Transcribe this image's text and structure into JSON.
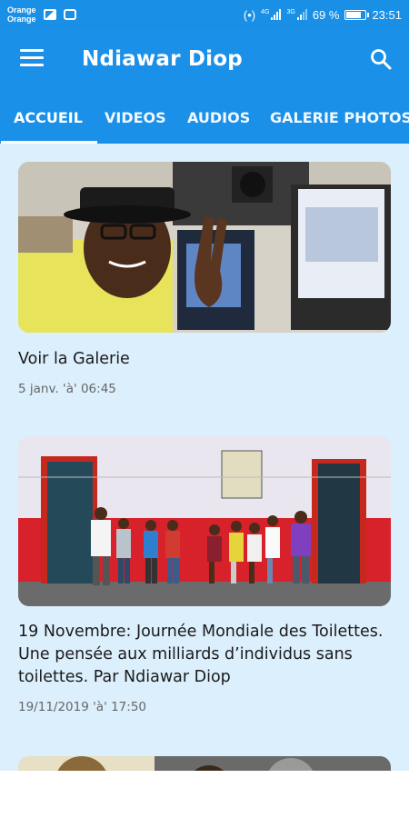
{
  "status_bar": {
    "carrier_line1": "Orange",
    "carrier_line2": "Orange",
    "network1": "4G",
    "network2": "3G",
    "battery_text": "69 %",
    "battery_level": 0.69,
    "time": "23:51"
  },
  "app_bar": {
    "title": "Ndiawar Diop"
  },
  "tabs": [
    {
      "label": "ACCUEIL",
      "active": true
    },
    {
      "label": "VIDEOS",
      "active": false
    },
    {
      "label": "AUDIOS",
      "active": false
    },
    {
      "label": "GALERIE PHOTOS",
      "active": false
    }
  ],
  "posts": [
    {
      "title": "Voir la Galerie",
      "date": "5 janv. 'à' 06:45"
    },
    {
      "title": "19 Novembre: Journée Mondiale des Toilettes. Une pensée aux milliards d’individus sans toilettes. Par Ndiawar Diop",
      "date": "19/11/2019 'à' 17:50"
    }
  ],
  "colors": {
    "primary": "#1a90e8",
    "content_bg": "#dceffd",
    "text": "#1a1a1a",
    "date": "#666666"
  }
}
